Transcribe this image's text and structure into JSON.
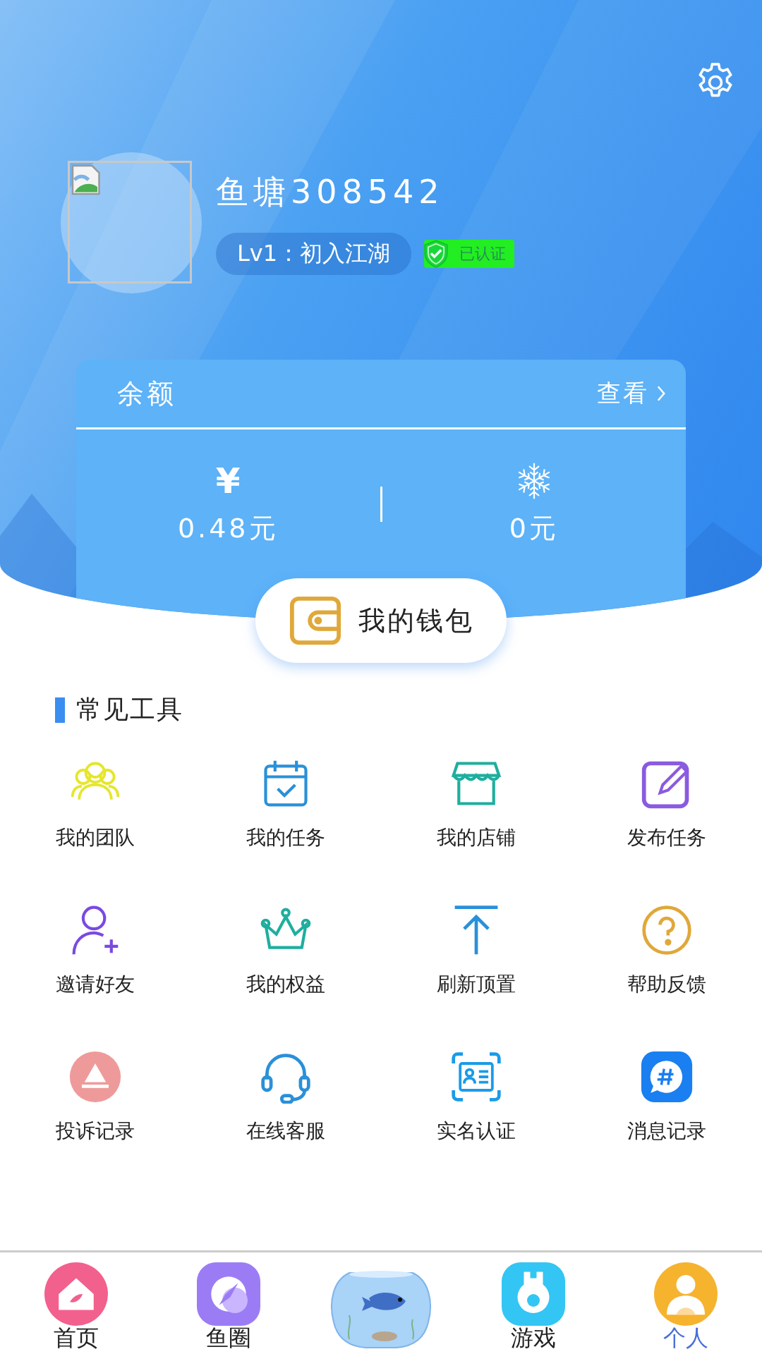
{
  "profile": {
    "name": "鱼塘308542",
    "level": "Lv1：初入江湖",
    "verified": true,
    "verified_label": "已认证"
  },
  "balance": {
    "title": "余额",
    "link": "查看",
    "available": {
      "symbol": "¥",
      "amount": "0.48元"
    },
    "frozen": {
      "amount": "0元"
    }
  },
  "wallet_button": "我的钱包",
  "tools": {
    "title": "常见工具",
    "items": [
      {
        "label": "我的团队"
      },
      {
        "label": "我的任务"
      },
      {
        "label": "我的店铺"
      },
      {
        "label": "发布任务"
      },
      {
        "label": "邀请好友"
      },
      {
        "label": "我的权益"
      },
      {
        "label": "刷新顶置"
      },
      {
        "label": "帮助反馈"
      },
      {
        "label": "投诉记录"
      },
      {
        "label": "在线客服"
      },
      {
        "label": "实名认证"
      },
      {
        "label": "消息记录"
      }
    ]
  },
  "nav": [
    {
      "kind": "tab",
      "label": "首页",
      "selected": false
    },
    {
      "kind": "tab",
      "label": "鱼圈",
      "selected": false
    },
    {
      "kind": "center"
    },
    {
      "kind": "tab",
      "label": "游戏",
      "selected": false
    },
    {
      "kind": "tab",
      "label": "个人",
      "selected": true
    }
  ]
}
